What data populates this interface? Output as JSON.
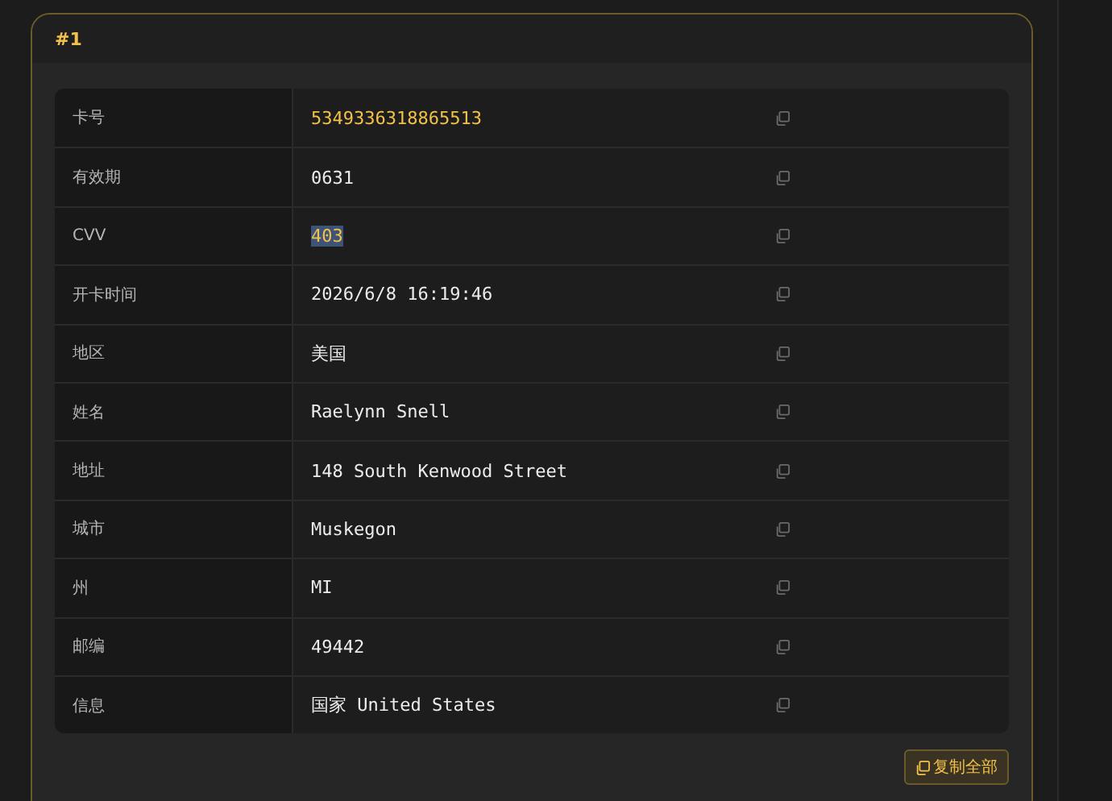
{
  "card": {
    "title": "#1",
    "rows": [
      {
        "label": "卡号",
        "value": "5349336318865513",
        "accent": true,
        "text_selected": false
      },
      {
        "label": "有效期",
        "value": "0631",
        "accent": false,
        "text_selected": false
      },
      {
        "label": "CVV",
        "value": "403",
        "accent": true,
        "text_selected": true
      },
      {
        "label": "开卡时间",
        "value": "2026/6/8 16:19:46",
        "accent": false,
        "text_selected": false
      },
      {
        "label": "地区",
        "value": "美国",
        "accent": false,
        "text_selected": false
      },
      {
        "label": "姓名",
        "value": "Raelynn Snell",
        "accent": false,
        "text_selected": false
      },
      {
        "label": "地址",
        "value": "148 South Kenwood Street",
        "accent": false,
        "text_selected": false
      },
      {
        "label": "城市",
        "value": "Muskegon",
        "accent": false,
        "text_selected": false
      },
      {
        "label": "州",
        "value": "MI",
        "accent": false,
        "text_selected": false
      },
      {
        "label": "邮编",
        "value": "49442",
        "accent": false,
        "text_selected": false
      },
      {
        "label": "信息",
        "value": "国家 United States",
        "accent": false,
        "text_selected": false
      }
    ],
    "copy_all_button": "复制全部"
  }
}
